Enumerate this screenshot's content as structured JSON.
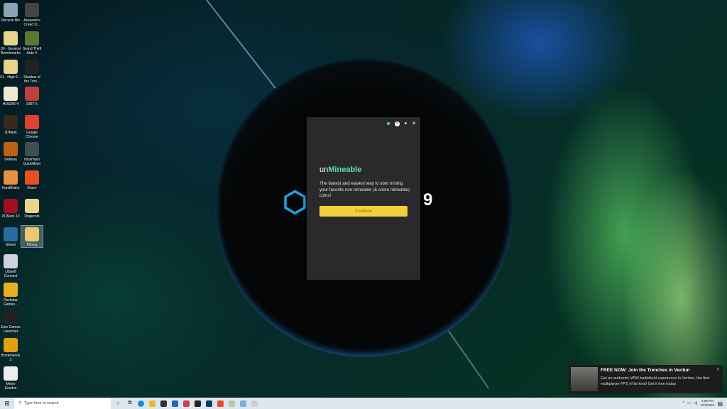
{
  "desktop": {
    "col1": [
      "Recycle Bin",
      "00 - General Benchmarks",
      "01 - High E...",
      "HDSR874",
      "3DMark",
      "VRMark",
      "HandBrake",
      "PCMark 10",
      "Steam",
      "Ubisoft Connect",
      "Rockstar Games...",
      "Epic Games Launcher",
      "Borderlands 3",
      "Metro Exodus"
    ],
    "col2": [
      "Assassin's Creed O...",
      "Grand Theft Auto V",
      "Shadow of the Tom...",
      "DiRT 5",
      "Google Chrome",
      "NiceHash QuickMiner",
      "Brave",
      "Dogecoin",
      "Mining"
    ],
    "selected": "Mining"
  },
  "dialog": {
    "brand_prefix": "un",
    "brand_name": "Mineable",
    "description": "The fastest and easiest way to start mining your favorite non-mineable (& some mineable) coins!",
    "continue_label": "Continue",
    "info": "i",
    "pin": "▾",
    "close": "✕"
  },
  "wallpaper": {
    "logo_left": "⬡",
    "logo_right": "9"
  },
  "toast": {
    "title": "FREE NOW: Join the Trenches in Verdun",
    "body": "Get an authentic WWI battlefield experience in Verdun, the first multiplayer FPS of its kind! Get it free today.",
    "close": "✕"
  },
  "taskbar": {
    "search_placeholder": "Type here to search",
    "time": "3:58 PM",
    "date": "7/23/2021"
  },
  "colors": {
    "accent": "#5fe3a9",
    "button": "#f2cf3c"
  }
}
